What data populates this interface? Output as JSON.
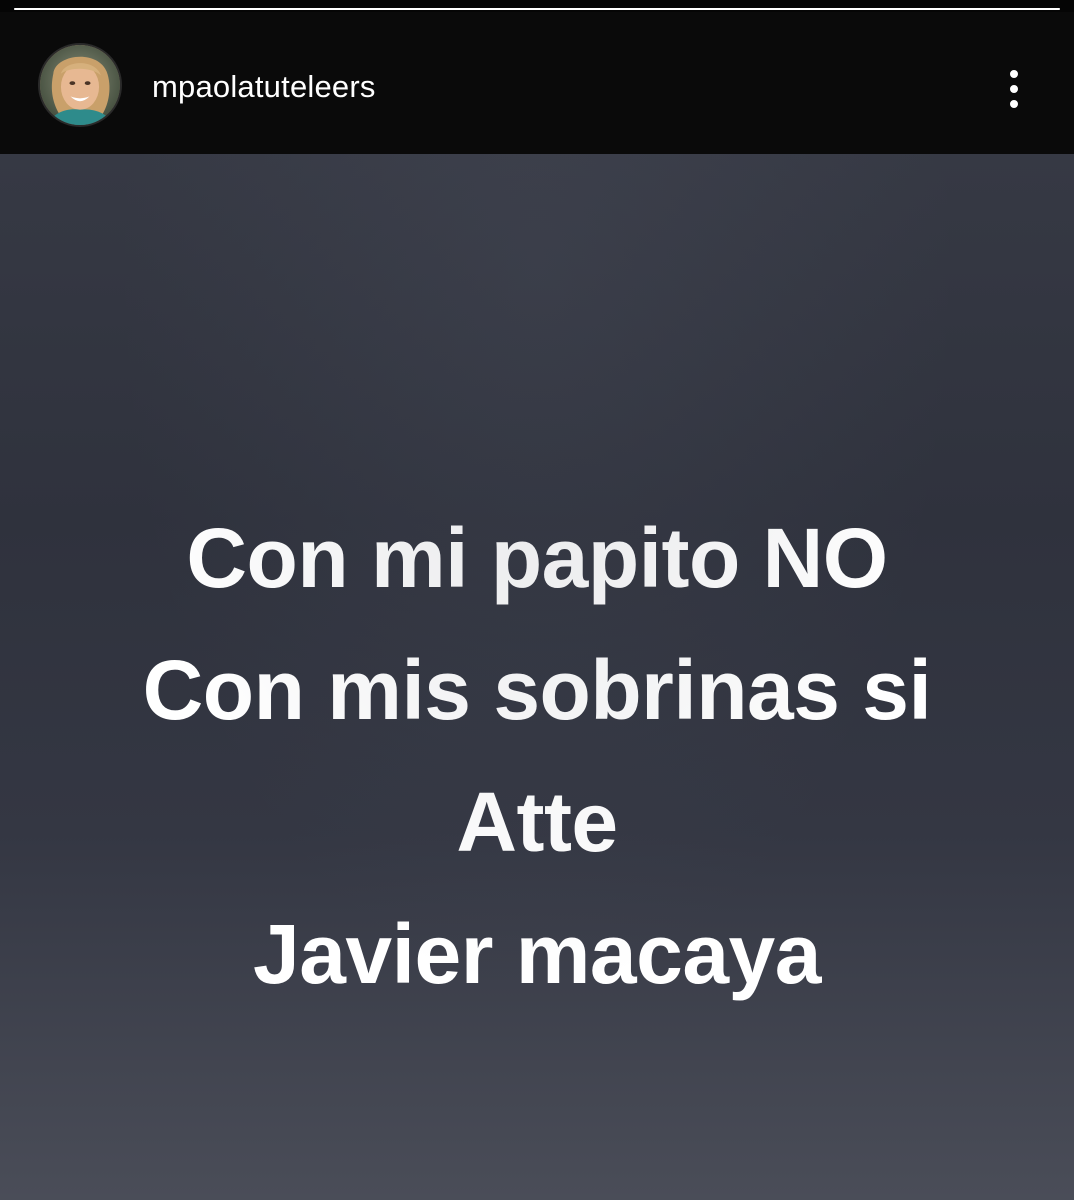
{
  "header": {
    "username": "mpaolatuteleers",
    "avatar_icon": "profile-photo",
    "menu_icon": "more-vertical-icon"
  },
  "story": {
    "progress": 1.0,
    "lines": [
      "Con mi papito NO",
      "Con mis sobrinas si",
      "Atte",
      "Javier macaya"
    ]
  },
  "colors": {
    "header_bg": "#0a0a0a",
    "story_bg_top": "#363944",
    "story_bg_bottom": "#4a4d58",
    "text": "#ffffff"
  }
}
